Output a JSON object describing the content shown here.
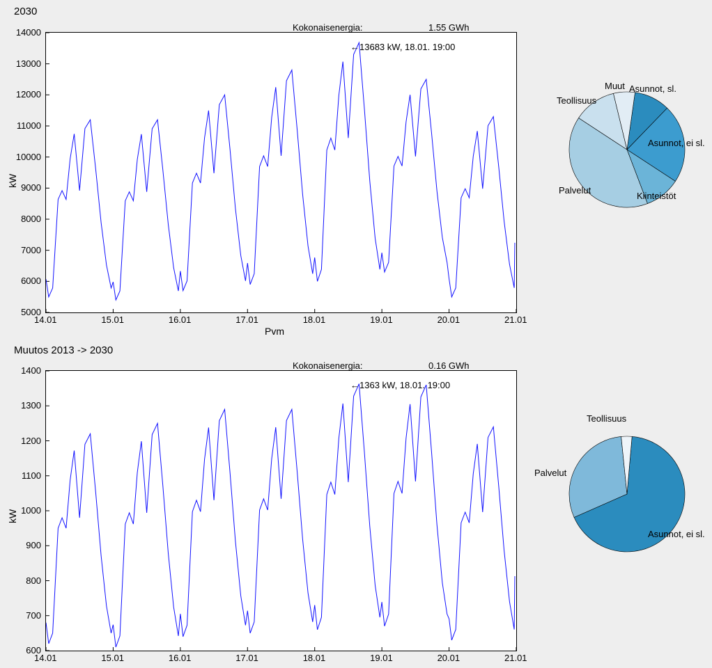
{
  "top": {
    "title": "2030",
    "energy_label": "Kokonaisenergia:",
    "energy_value": "1.55 GWh",
    "annotation": "13683 kW, 18.01. 19:00",
    "xlabel": "Pvm",
    "ylabel": "kW",
    "xticks": [
      "14.01",
      "15.01",
      "16.01",
      "17.01",
      "18.01",
      "19.01",
      "20.01",
      "21.01"
    ],
    "yticks": [
      "5000",
      "6000",
      "7000",
      "8000",
      "9000",
      "10000",
      "11000",
      "12000",
      "13000",
      "14000"
    ],
    "pie_labels": {
      "muut": "Muut",
      "asunnot_sl": "Asunnot, sl.",
      "teollisuus": "Teollisuus",
      "asunnot_ei_sl": "Asunnot, ei sl.",
      "palvelut": "Palvelut",
      "kiinteistot": "Kiinteistöt"
    }
  },
  "bottom": {
    "title": "Muutos 2013 -> 2030",
    "energy_label": "Kokonaisenergia:",
    "energy_value": "0.16 GWh",
    "annotation": "1363 kW, 18.01. 19:00",
    "ylabel": "kW",
    "xticks": [
      "14.01",
      "15.01",
      "16.01",
      "17.01",
      "18.01",
      "19.01",
      "20.01",
      "21.01"
    ],
    "yticks": [
      "600",
      "700",
      "800",
      "900",
      "1000",
      "1100",
      "1200",
      "1300",
      "1400"
    ],
    "pie_labels": {
      "teollisuus": "Teollisuus",
      "palvelut": "Palvelut",
      "asunnot_ei_sl": "Asunnot, ei sl."
    }
  },
  "chart_data": [
    {
      "type": "line",
      "title": "2030",
      "xlabel": "Pvm",
      "ylabel": "kW",
      "ylim": [
        5000,
        14000
      ],
      "x_categories": [
        "14.01",
        "15.01",
        "16.01",
        "17.01",
        "18.01",
        "19.01",
        "20.01",
        "21.01"
      ],
      "annotation": {
        "text": "13683 kW, 18.01. 19:00",
        "x": "18.01 19:00",
        "y": 13683
      },
      "series": [
        {
          "name": "kW",
          "approx_daily_min_max": [
            {
              "day": "14.01",
              "min": 5500,
              "max": 11200
            },
            {
              "day": "15.01",
              "min": 5400,
              "max": 11200
            },
            {
              "day": "16.01",
              "min": 5700,
              "max": 12000
            },
            {
              "day": "17.01",
              "min": 5900,
              "max": 12800
            },
            {
              "day": "18.01",
              "min": 6000,
              "max": 13683
            },
            {
              "day": "19.01",
              "min": 6300,
              "max": 12500
            },
            {
              "day": "20.01",
              "min": 5500,
              "max": 11300
            }
          ]
        }
      ],
      "header": {
        "label": "Kokonaisenergia:",
        "value": "1.55 GWh"
      }
    },
    {
      "type": "pie",
      "title": "2030 breakdown",
      "categories": [
        "Asunnot, sl.",
        "Asunnot, ei sl.",
        "Kiinteistöt",
        "Palvelut",
        "Teollisuus",
        "Muut"
      ],
      "values": [
        10,
        22,
        10,
        40,
        12,
        6
      ]
    },
    {
      "type": "line",
      "title": "Muutos 2013 -> 2030",
      "ylabel": "kW",
      "ylim": [
        600,
        1400
      ],
      "x_categories": [
        "14.01",
        "15.01",
        "16.01",
        "17.01",
        "18.01",
        "19.01",
        "20.01",
        "21.01"
      ],
      "annotation": {
        "text": "1363 kW, 18.01. 19:00",
        "x": "18.01 19:00",
        "y": 1363
      },
      "series": [
        {
          "name": "kW",
          "approx_daily_min_max": [
            {
              "day": "14.01",
              "min": 620,
              "max": 1220
            },
            {
              "day": "15.01",
              "min": 610,
              "max": 1250
            },
            {
              "day": "16.01",
              "min": 640,
              "max": 1290
            },
            {
              "day": "17.01",
              "min": 650,
              "max": 1290
            },
            {
              "day": "18.01",
              "min": 660,
              "max": 1363
            },
            {
              "day": "19.01",
              "min": 670,
              "max": 1360
            },
            {
              "day": "20.01",
              "min": 630,
              "max": 1240
            }
          ]
        }
      ],
      "header": {
        "label": "Kokonaisenergia:",
        "value": "0.16 GWh"
      }
    },
    {
      "type": "pie",
      "title": "Muutos breakdown",
      "categories": [
        "Asunnot, ei sl.",
        "Palvelut",
        "Teollisuus"
      ],
      "values": [
        67,
        30,
        3
      ]
    }
  ]
}
